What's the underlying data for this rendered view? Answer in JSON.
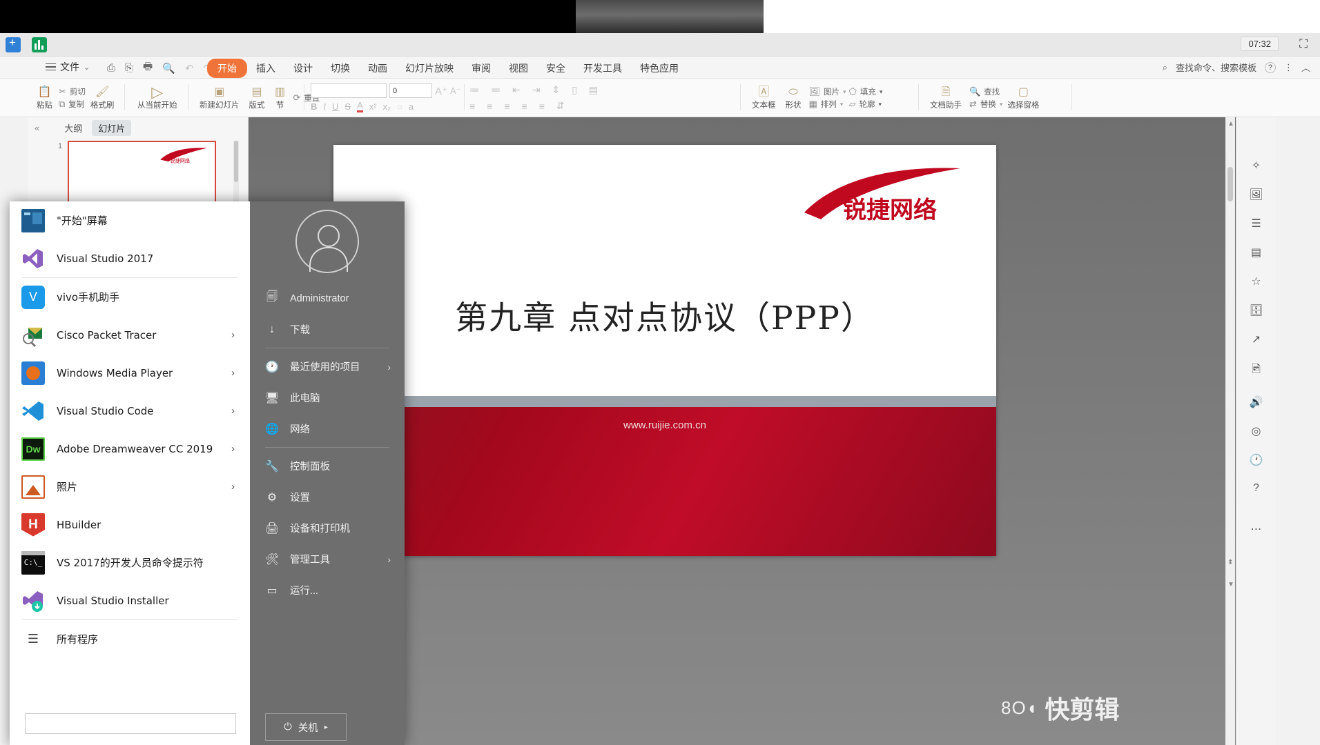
{
  "window": {
    "clock": "07:32",
    "minimize": "–",
    "maximize": "❐",
    "close": "✕",
    "fullscreen": "⛶"
  },
  "wps": {
    "file_menu": "文件",
    "file_caret": "⌄",
    "quick_access": [
      {
        "name": "save-icon",
        "glyph": "⎙"
      },
      {
        "name": "save-as-icon",
        "glyph": "⎘"
      },
      {
        "name": "print-icon",
        "glyph": "🖶"
      },
      {
        "name": "print-preview-icon",
        "glyph": "🔍"
      },
      {
        "name": "undo-icon",
        "glyph": "↶"
      },
      {
        "name": "redo-icon",
        "glyph": "↷"
      },
      {
        "name": "customize-icon",
        "glyph": "⌄"
      }
    ],
    "tabs": [
      {
        "label": "开始",
        "active": true
      },
      {
        "label": "插入",
        "active": false
      },
      {
        "label": "设计",
        "active": false
      },
      {
        "label": "切换",
        "active": false
      },
      {
        "label": "动画",
        "active": false
      },
      {
        "label": "幻灯片放映",
        "active": false
      },
      {
        "label": "审阅",
        "active": false
      },
      {
        "label": "视图",
        "active": false
      },
      {
        "label": "安全",
        "active": false
      },
      {
        "label": "开发工具",
        "active": false
      },
      {
        "label": "特色应用",
        "active": false
      }
    ],
    "search_hint": "查找命令、搜索模板",
    "help_glyph": "?",
    "more_glyph": "⋮",
    "collapse_glyph": "︿",
    "ribbon": {
      "clipboard": {
        "paste": "粘贴",
        "cut": "剪切",
        "copy": "复制",
        "format_painter": "格式刷"
      },
      "slideshow": {
        "from_current": "从当前开始"
      },
      "slides": {
        "new_slide": "新建幻灯片",
        "layout": "版式",
        "section": "节",
        "reset": "重置"
      },
      "font": {
        "font_name": "",
        "font_size": "0",
        "grow": "A",
        "shrink": "A",
        "bold": "B",
        "italic": "I",
        "underline": "U",
        "strike": "S",
        "font_color": "A",
        "superscript": "x²",
        "subscript": "x₂",
        "clear_format": "◌",
        "highlight": "a"
      },
      "paragraph": {
        "bullets": "≔",
        "numbering": "≕",
        "dec_indent": "⇤",
        "inc_indent": "⇥",
        "align_left": "≡",
        "align_center": "≡",
        "align_right": "≡",
        "justify": "≡",
        "distribute": "≡",
        "line_space": "⇕",
        "columns": "▯",
        "text_direction": "⇵",
        "align_text": "▤"
      },
      "drawing": {
        "text_box": "文本框",
        "shapes": "形状",
        "picture": "图片",
        "fill": "填充",
        "arrange": "排列",
        "outline": "轮廓"
      },
      "editing": {
        "doc_assistant": "文档助手",
        "find": "查找",
        "replace": "替换",
        "selection_pane": "选择窗格"
      }
    },
    "left_pane": {
      "outline_tab": "大纲",
      "slides_tab": "幻灯片",
      "collapse": "«",
      "slide_number": "1"
    }
  },
  "slide": {
    "title": "第九章 点对点协议（PPP）",
    "url": "www.ruijie.com.cn",
    "logo_alt": "锐捷网络"
  },
  "watermark": {
    "logo": "8O◖",
    "text": "快剪辑"
  },
  "start_menu": {
    "programs": [
      {
        "label": "\"开始\"屏幕",
        "icon": "start-screen-icon",
        "arrow": false,
        "divider_after": false
      },
      {
        "label": "Visual Studio 2017",
        "icon": "visual-studio-icon",
        "arrow": false,
        "divider_after": true
      },
      {
        "label": "vivo手机助手",
        "icon": "vivo-assistant-icon",
        "arrow": false,
        "divider_after": false
      },
      {
        "label": "Cisco Packet Tracer",
        "icon": "cisco-packet-tracer-icon",
        "arrow": true,
        "divider_after": false
      },
      {
        "label": "Windows Media Player",
        "icon": "windows-media-player-icon",
        "arrow": true,
        "divider_after": false
      },
      {
        "label": "Visual Studio Code",
        "icon": "vscode-icon",
        "arrow": true,
        "divider_after": false
      },
      {
        "label": "Adobe Dreamweaver CC 2019",
        "icon": "dreamweaver-icon",
        "arrow": true,
        "divider_after": false
      },
      {
        "label": "照片",
        "icon": "photos-icon",
        "arrow": true,
        "divider_after": false
      },
      {
        "label": "HBuilder",
        "icon": "hbuilder-icon",
        "arrow": false,
        "divider_after": false
      },
      {
        "label": "VS 2017的开发人员命令提示符",
        "icon": "developer-command-prompt-icon",
        "arrow": false,
        "divider_after": false
      },
      {
        "label": "Visual Studio Installer",
        "icon": "visual-studio-installer-icon",
        "arrow": false,
        "divider_after": true
      },
      {
        "label": "所有程序",
        "icon": "all-programs-icon",
        "arrow": false,
        "divider_after": false
      }
    ],
    "search_placeholder": "",
    "right_items": [
      {
        "label": "Administrator",
        "icon": "user-account-icon",
        "arrow": false,
        "divider_after": false
      },
      {
        "label": "下载",
        "icon": "downloads-icon",
        "arrow": false,
        "divider_after": true
      },
      {
        "label": "最近使用的项目",
        "icon": "recent-items-icon",
        "arrow": true,
        "divider_after": false
      },
      {
        "label": "此电脑",
        "icon": "this-pc-icon",
        "arrow": false,
        "divider_after": false
      },
      {
        "label": "网络",
        "icon": "network-icon",
        "arrow": false,
        "divider_after": true
      },
      {
        "label": "控制面板",
        "icon": "control-panel-icon",
        "arrow": false,
        "divider_after": false
      },
      {
        "label": "设置",
        "icon": "settings-icon",
        "arrow": false,
        "divider_after": false
      },
      {
        "label": "设备和打印机",
        "icon": "devices-printers-icon",
        "arrow": false,
        "divider_after": false
      },
      {
        "label": "管理工具",
        "icon": "admin-tools-icon",
        "arrow": true,
        "divider_after": false
      },
      {
        "label": "运行...",
        "icon": "run-icon",
        "arrow": false,
        "divider_after": false
      }
    ],
    "power_label": "关机",
    "power_icon": "power-icon",
    "power_arrow": "▸"
  },
  "colors": {
    "accent_orange": "#f0743a",
    "wps_green": "#24b871",
    "ruijie_red": "#c0081f",
    "start_menu_gray": "#6e6e6e"
  }
}
